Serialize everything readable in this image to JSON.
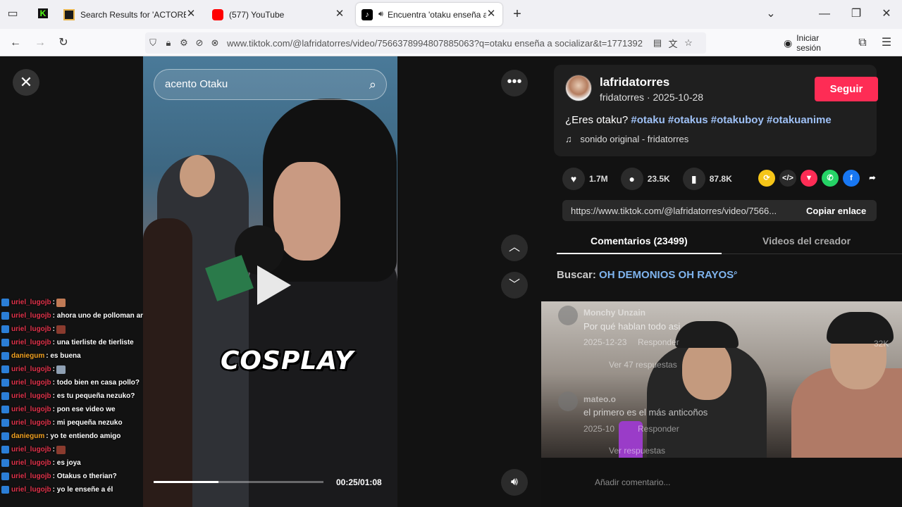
{
  "browser": {
    "tabs": [
      {
        "title": "Search Results for 'ACTORES DE",
        "fav_color": "#1a1a1a"
      },
      {
        "title": "(577) YouTube",
        "fav_color": "#ff0000"
      },
      {
        "title": "Encuentra 'otaku enseña a",
        "fav_color": "#000000"
      }
    ],
    "url": "www.tiktok.com/@lafridatorres/video/7566378994807885063?q=otaku enseña a socializar&t=1771392",
    "signin_label": "Iniciar sesión"
  },
  "video": {
    "search_text": "acento Otaku",
    "caption": "COSPLAY",
    "time": "00:25/01:08",
    "progress_fraction": 0.38
  },
  "creator": {
    "username": "lafridatorres",
    "subline": "fridatorres · 2025-10-28",
    "follow_label": "Seguir",
    "desc_prefix": "¿Eres otaku?",
    "hashtags": [
      "#otaku",
      "#otakus",
      "#otakuboy",
      "#otakuanime"
    ],
    "sound": "sonido original - fridatorres"
  },
  "stats": {
    "likes": "1.7M",
    "comments": "23.5K",
    "saves": "87.8K"
  },
  "share": {
    "link": "https://www.tiktok.com/@lafridatorres/video/7566...",
    "copy_label": "Copiar enlace"
  },
  "panel_tabs": {
    "comments": "Comentarios (23499)",
    "creator_videos": "Videos del creador"
  },
  "search_suggest": {
    "label": "Buscar:",
    "query": "OH DEMONIOS OH RAYOS"
  },
  "comments": [
    {
      "user": "Monchy Unzain",
      "text": "Por qué hablan todo asi",
      "date": "2025-12-23",
      "reply": "Responder",
      "likes": "32K",
      "more": "Ver 47 respuestas"
    },
    {
      "user": "mateo.o",
      "text": "el primero es el más anticoños",
      "date": "2025-10",
      "reply": "Responder",
      "more": "Ver respuestas"
    }
  ],
  "add_comment": "Añadir comentario...",
  "chat": [
    {
      "user": "uriel_lugojb",
      "msg": ":",
      "emote": "#c07a55"
    },
    {
      "user": "uriel_lugojb",
      "msg": ": ahora uno de polloman and friends"
    },
    {
      "user": "uriel_lugojb",
      "msg": ":",
      "emote": "#8a3b2e"
    },
    {
      "user": "uriel_lugojb",
      "msg": ": una tierliste de tierliste"
    },
    {
      "user": "daniegum",
      "msg": ": es buena"
    },
    {
      "user": "uriel_lugojb",
      "msg": ":",
      "emote": "#8fa0b3"
    },
    {
      "user": "uriel_lugojb",
      "msg": ": todo bien en casa pollo?"
    },
    {
      "user": "uriel_lugojb",
      "msg": ": es tu pequeña nezuko?"
    },
    {
      "user": "uriel_lugojb",
      "msg": ": pon ese video we"
    },
    {
      "user": "uriel_lugojb",
      "msg": ": mi pequeña nezuko"
    },
    {
      "user": "daniegum",
      "msg": ": yo te entiendo amigo"
    },
    {
      "user": "uriel_lugojb",
      "msg": ":",
      "emote": "#8a3b2e"
    },
    {
      "user": "uriel_lugojb",
      "msg": ": es joya"
    },
    {
      "user": "uriel_lugojb",
      "msg": ": Otakus o therian?"
    },
    {
      "user": "uriel_lugojb",
      "msg": ": yo le enseñe a él"
    }
  ],
  "colors": {
    "chat_user_uriel": "#e0324a",
    "chat_user_danie": "#f0a020",
    "follow": "#fe2c55",
    "hashtag": "#9ec0f5"
  }
}
